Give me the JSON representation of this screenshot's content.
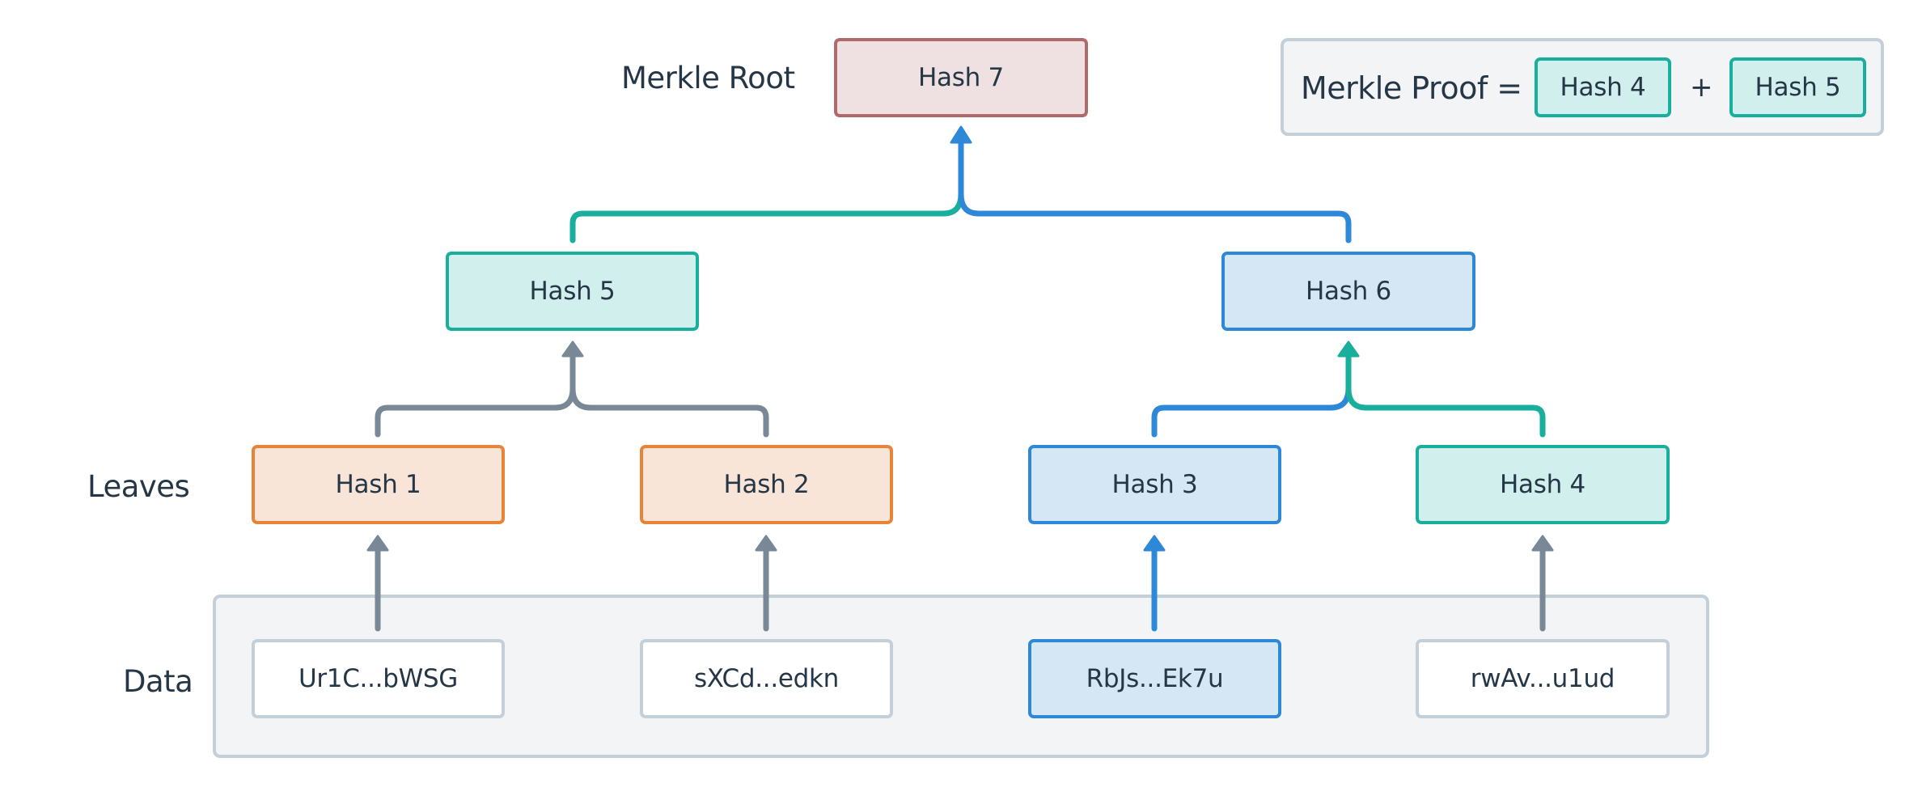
{
  "colors": {
    "text": "#253746",
    "gray_stroke": "#788896",
    "teal": "#1aae9c",
    "blue": "#2e88d8",
    "root_border": "#b06a69",
    "orange": "#e8843a",
    "container_border": "#c3cfd9",
    "container_fill": "#f3f4f6"
  },
  "labels": {
    "merkle_root": "Merkle Root",
    "leaves": "Leaves",
    "data": "Data"
  },
  "root": {
    "label": "Hash 7"
  },
  "intermediate": [
    {
      "label": "Hash 5",
      "style": "teal"
    },
    {
      "label": "Hash 6",
      "style": "blue"
    }
  ],
  "leaves": [
    {
      "label": "Hash 1",
      "style": "orange"
    },
    {
      "label": "Hash 2",
      "style": "orange"
    },
    {
      "label": "Hash 3",
      "style": "blue"
    },
    {
      "label": "Hash 4",
      "style": "teal"
    }
  ],
  "data_items": [
    {
      "label": "Ur1C...bWSG",
      "style": "data"
    },
    {
      "label": "sXCd...edkn",
      "style": "data"
    },
    {
      "label": "RbJs...Ek7u",
      "style": "blue"
    },
    {
      "label": "rwAv...u1ud",
      "style": "data"
    }
  ],
  "proof": {
    "prefix": "Merkle Proof =",
    "operator": "+",
    "items": [
      "Hash 4",
      "Hash 5"
    ]
  }
}
